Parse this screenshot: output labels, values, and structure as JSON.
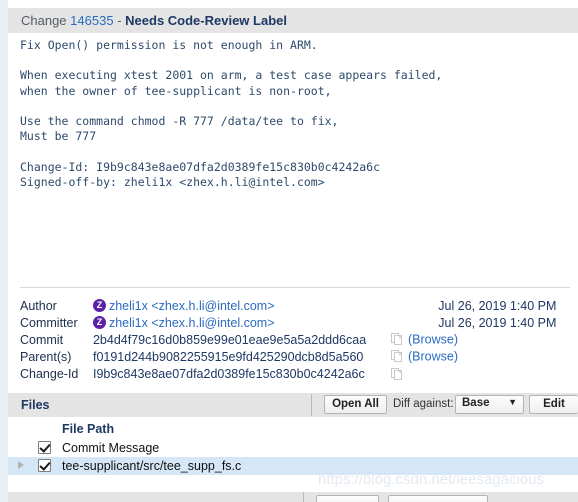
{
  "header": {
    "change_label": "Change",
    "change_number": "146535",
    "dash": "-",
    "status": "Needs Code-Review Label"
  },
  "commit_message": "Fix Open() permission is not enough in ARM.\n\nWhen executing xtest 2001 on arm, a test case appears failed,\nwhen the owner of tee-supplicant is non-root,\n\nUse the command chmod -R 777 /data/tee to fix,\nMust be 777\n\nChange-Id: I9b9c843e8ae07dfa2d0389fe15c830b0c4242a6c\nSigned-off-by: zheli1x <zhex.h.li@intel.com>",
  "metadata": {
    "rows": [
      {
        "key": "Author",
        "avatar_initial": "Z",
        "value": "zheli1x <zhex.h.li@intel.com>",
        "extra": "",
        "date": "Jul 26, 2019 1:40 PM"
      },
      {
        "key": "Committer",
        "avatar_initial": "Z",
        "value": "zheli1x <zhex.h.li@intel.com>",
        "extra": "",
        "date": "Jul 26, 2019 1:40 PM"
      },
      {
        "key": "Commit",
        "avatar_initial": "",
        "value": "2b4d4f79c16d0b859e99e01eae9e5a5a2ddd6caa",
        "extra": "(Browse)",
        "date": ""
      },
      {
        "key": "Parent(s)",
        "avatar_initial": "",
        "value": "f0191d244b9082255915e9fd425290dcb8d5a560",
        "extra": "(Browse)",
        "date": ""
      },
      {
        "key": "Change-Id",
        "avatar_initial": "",
        "value": "I9b9c843e8ae07dfa2d0389fe15c830b0c4242a6c",
        "extra": "",
        "date": ""
      }
    ]
  },
  "files": {
    "section_title": "Files",
    "open_all_label": "Open All",
    "diff_against_label": "Diff against:",
    "diff_against_value": "Base",
    "edit_label": "Edit",
    "column_header": "File Path",
    "rows": [
      {
        "label": "Commit Message",
        "checked": true,
        "expandable": false,
        "selected": false
      },
      {
        "label": "tee-supplicant/src/tee_supp_fs.c",
        "checked": true,
        "expandable": true,
        "selected": true
      }
    ]
  },
  "watermark": "https://blog.csdn.net/leesagacious",
  "colors": {
    "header_bg": "#e4e4e4",
    "link": "#2b6bc0",
    "title_text": "#1f3864",
    "code_text": "#2e4a6b",
    "avatar_bg": "#5b21a8",
    "selected_row": "#d5e7f7",
    "gutter": "#e7f0f7"
  }
}
